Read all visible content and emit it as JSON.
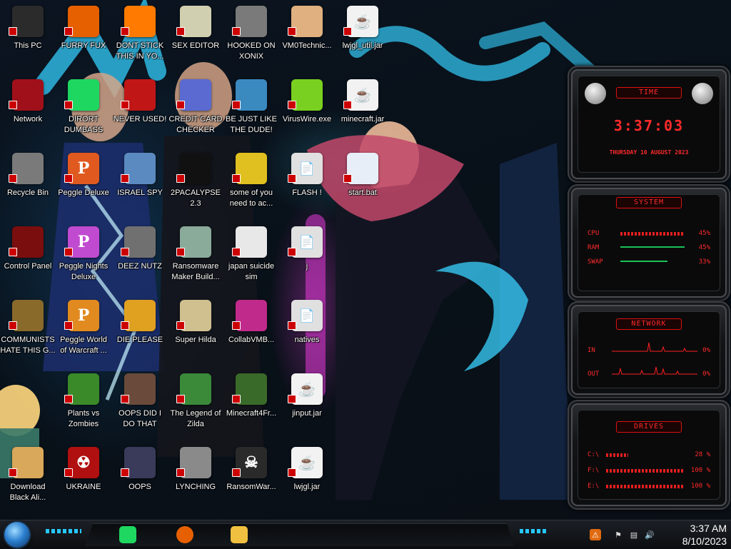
{
  "desktop_icons": [
    {
      "label": "This PC",
      "icon": "computer-icon",
      "color": "#2b2b2b",
      "col": 0,
      "row": 0
    },
    {
      "label": "Network",
      "icon": "network-icon",
      "color": "#a0101a",
      "col": 0,
      "row": 1
    },
    {
      "label": "Recycle Bin",
      "icon": "recycle-bin-icon",
      "color": "#7a7a7a",
      "col": 0,
      "row": 2
    },
    {
      "label": "Control Panel",
      "icon": "control-panel-icon",
      "color": "#7a0d0d",
      "col": 0,
      "row": 3
    },
    {
      "label": "COMMUNISTS HATE THIS G...",
      "icon": "money-bag-icon",
      "color": "#8a6a2a",
      "col": 0,
      "row": 4
    },
    {
      "label": "Download Black Ali...",
      "icon": "cartoon-icon",
      "color": "#d9a85a",
      "col": 0,
      "row": 6
    },
    {
      "label": "FURRY FUX",
      "icon": "firefox-icon",
      "color": "#e66000",
      "col": 1,
      "row": 0
    },
    {
      "label": "DIRORT DUMBASS",
      "icon": "chat-app-icon",
      "color": "#1ed760",
      "col": 1,
      "row": 1
    },
    {
      "label": "Peggle Deluxe",
      "icon": "peggle-icon",
      "color": "#e05a20",
      "col": 1,
      "row": 2
    },
    {
      "label": "Peggle Nights Deluxe",
      "icon": "peggle-icon",
      "color": "#c04ad0",
      "col": 1,
      "row": 3
    },
    {
      "label": "Peggle World of Warcraft ...",
      "icon": "peggle-icon",
      "color": "#e08a20",
      "col": 1,
      "row": 4
    },
    {
      "label": "Plants vs Zombies",
      "icon": "plant-icon",
      "color": "#3a8a2a",
      "col": 1,
      "row": 5
    },
    {
      "label": "UKRAINE",
      "icon": "radiation-icon",
      "color": "#b01010",
      "col": 1,
      "row": 6
    },
    {
      "label": "DONT STICK THIS IN YO...",
      "icon": "traffic-cone-icon",
      "color": "#ff7a00",
      "col": 2,
      "row": 0
    },
    {
      "label": "NEVER USED!",
      "icon": "dev-cpp-icon",
      "color": "#c01616",
      "col": 2,
      "row": 1
    },
    {
      "label": "ISRAEL SPY",
      "icon": "mail-icon",
      "color": "#5a8ac0",
      "col": 2,
      "row": 2
    },
    {
      "label": "DEEZ NUTZ",
      "icon": "windows-stack-icon",
      "color": "#707070",
      "col": 2,
      "row": 3
    },
    {
      "label": "DIE PLEASE",
      "icon": "de-icon",
      "color": "#e0a020",
      "col": 2,
      "row": 4
    },
    {
      "label": "OOPS DID I DO THAT",
      "icon": "portrait-icon",
      "color": "#6a4a3a",
      "col": 2,
      "row": 5
    },
    {
      "label": "OOPS",
      "icon": "monitor-icon",
      "color": "#3a3a5a",
      "col": 2,
      "row": 6
    },
    {
      "label": "SEX EDITOR",
      "icon": "hex-editor-icon",
      "color": "#d0d0b0",
      "col": 3,
      "row": 0
    },
    {
      "label": "CREDIT CARD CHECKER",
      "icon": "credit-card-icon",
      "color": "#5a6ad0",
      "col": 3,
      "row": 1
    },
    {
      "label": "2PACALYPSE 2.3",
      "icon": "terminal-icon",
      "color": "#111111",
      "col": 3,
      "row": 2
    },
    {
      "label": "Ransomware Maker Build...",
      "icon": "window-app-icon",
      "color": "#8aaa9a",
      "col": 3,
      "row": 3
    },
    {
      "label": "Super Hilda",
      "icon": "pixel-art-icon",
      "color": "#d0c090",
      "col": 3,
      "row": 4
    },
    {
      "label": "The Legend of Zilda",
      "icon": "pixel-hero-icon",
      "color": "#3a8a3a",
      "col": 3,
      "row": 5
    },
    {
      "label": "LYNCHING",
      "icon": "rope-icon",
      "color": "#8a8a8a",
      "col": 3,
      "row": 6
    },
    {
      "label": "HOOKED ON XONIX",
      "icon": "xonix-icon",
      "color": "#7a7a7a",
      "col": 4,
      "row": 0
    },
    {
      "label": "BE JUST LIKE THE DUDE!",
      "icon": "dude-icon",
      "color": "#3a8ac0",
      "col": 4,
      "row": 1
    },
    {
      "label": "some of you need to ac...",
      "icon": "beaver-icon",
      "color": "#e0c020",
      "col": 4,
      "row": 2
    },
    {
      "label": "japan suicide sim",
      "icon": "document-icon",
      "color": "#e8e8e8",
      "col": 4,
      "row": 3
    },
    {
      "label": "CollabVMB...",
      "icon": "collabvm-icon",
      "color": "#c02a8a",
      "col": 4,
      "row": 4
    },
    {
      "label": "Minecraft4Fr...",
      "icon": "minecraft-block-icon",
      "color": "#3a6a2a",
      "col": 4,
      "row": 5
    },
    {
      "label": "RansomWar...",
      "icon": "skull-icon",
      "color": "#2a2a2a",
      "col": 4,
      "row": 6
    },
    {
      "label": "VM0Technic...",
      "icon": "doctor-icon",
      "color": "#e0b080",
      "col": 5,
      "row": 0
    },
    {
      "label": "VirusWire.exe",
      "icon": "lime-icon",
      "color": "#7ad020",
      "col": 5,
      "row": 1
    },
    {
      "label": "FLASH !",
      "icon": "file-icon",
      "color": "#e0e0e0",
      "col": 5,
      "row": 2
    },
    {
      "label": "j",
      "icon": "file-icon",
      "color": "#e0e0e0",
      "col": 5,
      "row": 3
    },
    {
      "label": "natives",
      "icon": "file-icon",
      "color": "#e0e0e0",
      "col": 5,
      "row": 4
    },
    {
      "label": "jinput.jar",
      "icon": "java-icon",
      "color": "#f2f2f2",
      "col": 5,
      "row": 5
    },
    {
      "label": "lwjgl.jar",
      "icon": "java-icon",
      "color": "#f2f2f2",
      "col": 5,
      "row": 6
    },
    {
      "label": "lwjgl_util.jar",
      "icon": "java-icon",
      "color": "#f2f2f2",
      "col": 6,
      "row": 0
    },
    {
      "label": "minecraft.jar",
      "icon": "java-icon",
      "color": "#f2f2f2",
      "col": 6,
      "row": 1
    },
    {
      "label": "start.bat",
      "icon": "gear-script-icon",
      "color": "#e8eef8",
      "col": 6,
      "row": 2
    }
  ],
  "gadgets": {
    "time": {
      "title": "TIME",
      "time": "3:37:03",
      "date": "THURSDAY 10 AUGUST 2023"
    },
    "system": {
      "title": "SYSTEM",
      "rows": [
        {
          "label": "CPU",
          "value": "45%",
          "fill": 0.45
        },
        {
          "label": "RAM",
          "value": "45%",
          "fill": 0.45
        },
        {
          "label": "SWAP",
          "value": "33%",
          "fill": 0.33
        }
      ]
    },
    "network": {
      "title": "NETWORK",
      "rows": [
        {
          "label": "IN",
          "value": "0%"
        },
        {
          "label": "OUT",
          "value": "0%"
        }
      ]
    },
    "drives": {
      "title": "DRIVES",
      "rows": [
        {
          "label": "C:\\",
          "value": "28 %",
          "fill": 0.28
        },
        {
          "label": "F:\\",
          "value": "100 %",
          "fill": 1.0
        },
        {
          "label": "E:\\",
          "value": "100 %",
          "fill": 1.0
        }
      ]
    }
  },
  "taskbar": {
    "pinned": [
      {
        "name": "chat-app",
        "color": "#1ed760"
      },
      {
        "name": "firefox",
        "color": "#e66000"
      },
      {
        "name": "file-explorer",
        "color": "#f0c040"
      }
    ],
    "tray": [
      "update-icon",
      "flag-icon",
      "network-tray-icon",
      "volume-icon"
    ],
    "clock_time": "3:37 AM",
    "clock_date": "8/10/2023"
  },
  "accent_cyan": "#27c8ff",
  "accent_red": "#ff2a2a"
}
